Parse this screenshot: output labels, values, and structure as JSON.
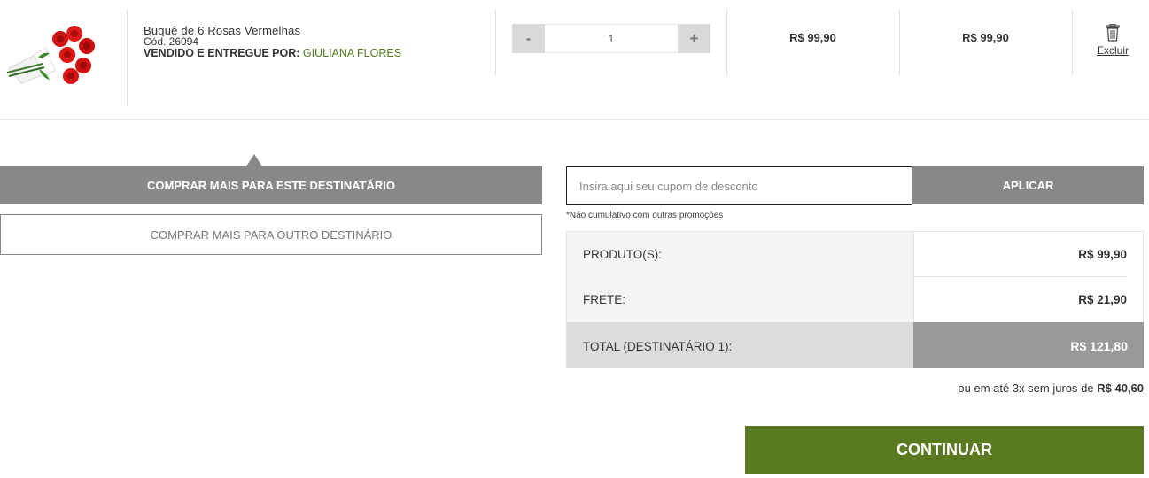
{
  "item": {
    "name": "Buquê de 6 Rosas Vermelhas",
    "code": "Cód. 26094",
    "seller_label": "VENDIDO E ENTREGUE POR:",
    "seller_name": "GIULIANA FLORES",
    "quantity": "1",
    "minus_label": "-",
    "plus_label": "+",
    "unit_price": "R$ 99,90",
    "subtotal": "R$ 99,90",
    "delete_label": "Excluir",
    "delete_icon": "trash-icon"
  },
  "actions": {
    "same_recipient": "COMPRAR MAIS PARA ESTE DESTINATÁRIO",
    "other_recipient": "COMPRAR MAIS PARA OUTRO DESTINÁRIO"
  },
  "coupon": {
    "placeholder": "Insira aqui seu cupom de desconto",
    "apply_label": "APLICAR",
    "note": "*Não cumulativo com outras promoções"
  },
  "summary": {
    "products_label": "PRODUTO(S):",
    "products_value": "R$ 99,90",
    "shipping_label": "FRETE:",
    "shipping_value": "R$ 21,90",
    "total_label": "TOTAL (DESTINATÁRIO 1):",
    "total_value": "R$ 121,80"
  },
  "installments": {
    "text": "ou em até 3x sem juros de",
    "value": "R$ 40,60"
  },
  "continue_label": "CONTINUAR",
  "colors": {
    "accent_green": "#5a7a22",
    "seller_green": "#4f7a23",
    "gray_button": "#888888"
  }
}
